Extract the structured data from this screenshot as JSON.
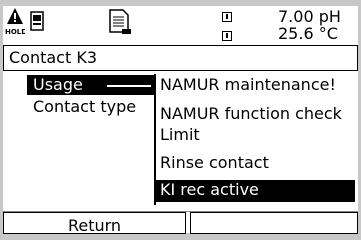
{
  "status": {
    "hold_label": "HOLD",
    "readings": [
      {
        "value": "7.00 pH"
      },
      {
        "value": "25.6 °C"
      }
    ],
    "icons": [
      "hold-icon",
      "card-icon",
      "document-icon",
      "measurement-icon"
    ]
  },
  "title": "Contact K3",
  "menu": {
    "items": [
      {
        "label": "Usage",
        "selected": true
      },
      {
        "label": "Contact type",
        "selected": false
      }
    ]
  },
  "dropdown": {
    "options": [
      {
        "label": "NAMUR maintenance!",
        "selected": false
      },
      {
        "label": "NAMUR function check",
        "selected": false
      },
      {
        "label": "Limit",
        "selected": false
      },
      {
        "label": "Rinse contact",
        "selected": false
      },
      {
        "label": "KI rec active",
        "selected": true
      }
    ]
  },
  "softkeys": {
    "left_label": "Return",
    "right_label": ""
  },
  "colors": {
    "highlight": "#000000",
    "background": "#ffffff",
    "frame": "#c8c8c8"
  }
}
